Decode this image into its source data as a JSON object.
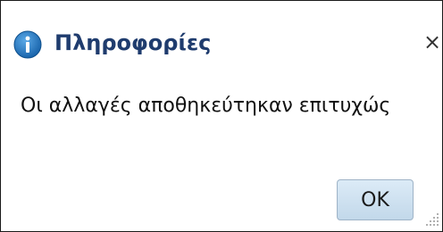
{
  "dialog": {
    "title": "Πληροφορίες",
    "title_icon": "info-icon",
    "close_label": "×",
    "message": "Οι αλλαγές αποθηκεύτηκαν επιτυχώς",
    "ok_label": "OK",
    "resize_icon": "resize-grip-icon"
  },
  "colors": {
    "title": "#1f3c6e",
    "icon_fill": "#1c6fb8",
    "ok_button": "#c9ddee",
    "border": "#1a1a1a"
  }
}
